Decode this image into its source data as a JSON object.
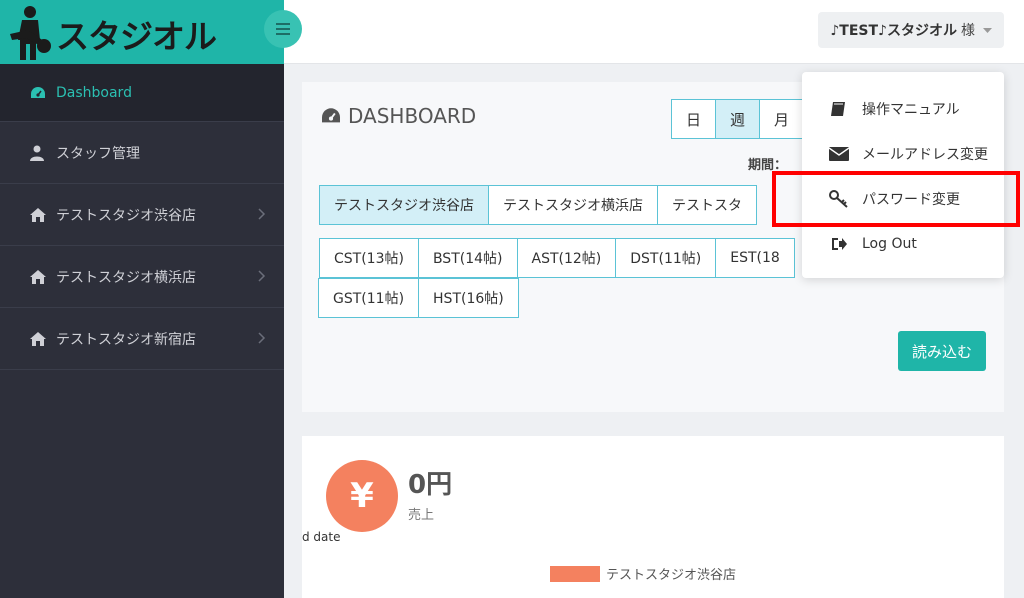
{
  "brand": {
    "name": "スタジオル"
  },
  "sidebar": {
    "items": [
      {
        "label": "Dashboard",
        "icon": "dashboard-icon",
        "active": true
      },
      {
        "label": "スタッフ管理",
        "icon": "user-icon"
      },
      {
        "label": "テストスタジオ渋谷店",
        "icon": "home-icon",
        "has_children": true
      },
      {
        "label": "テストスタジオ横浜店",
        "icon": "home-icon",
        "has_children": true
      },
      {
        "label": "テストスタジオ新宿店",
        "icon": "home-icon",
        "has_children": true
      }
    ]
  },
  "topbar": {
    "user_name": "♪TEST♪スタジオル",
    "user_suffix": "様"
  },
  "dashboard": {
    "title": "DASHBOARD",
    "period_tabs": [
      "日",
      "週",
      "月"
    ],
    "period_label": "期間：",
    "stores": [
      "テストスタジオ渋谷店",
      "テストスタジオ横浜店",
      "テストスタ"
    ],
    "rooms_row1": [
      "CST(13帖)",
      "BST(14帖)",
      "AST(12帖)",
      "DST(11帖)",
      "EST(18"
    ],
    "rooms_row2": [
      "GST(11帖)",
      "HST(16帖)"
    ],
    "load_button": "読み込む"
  },
  "sales": {
    "currency_symbol": "¥",
    "value": "0円",
    "label": "売上",
    "axis_fragment": "d date",
    "legend": "テストスタジオ渋谷店"
  },
  "dropdown": {
    "items": [
      {
        "label": "操作マニュアル",
        "icon": "book-icon"
      },
      {
        "label": "メールアドレス変更",
        "icon": "envelope-icon"
      },
      {
        "label": "パスワード変更",
        "icon": "key-icon",
        "highlighted": true
      },
      {
        "label": "Log Out",
        "icon": "logout-icon"
      }
    ]
  },
  "colors": {
    "accent": "#1fb5a8",
    "sidebar": "#2d2f3a",
    "sales": "#f4815f",
    "highlight": "#ff0000"
  }
}
